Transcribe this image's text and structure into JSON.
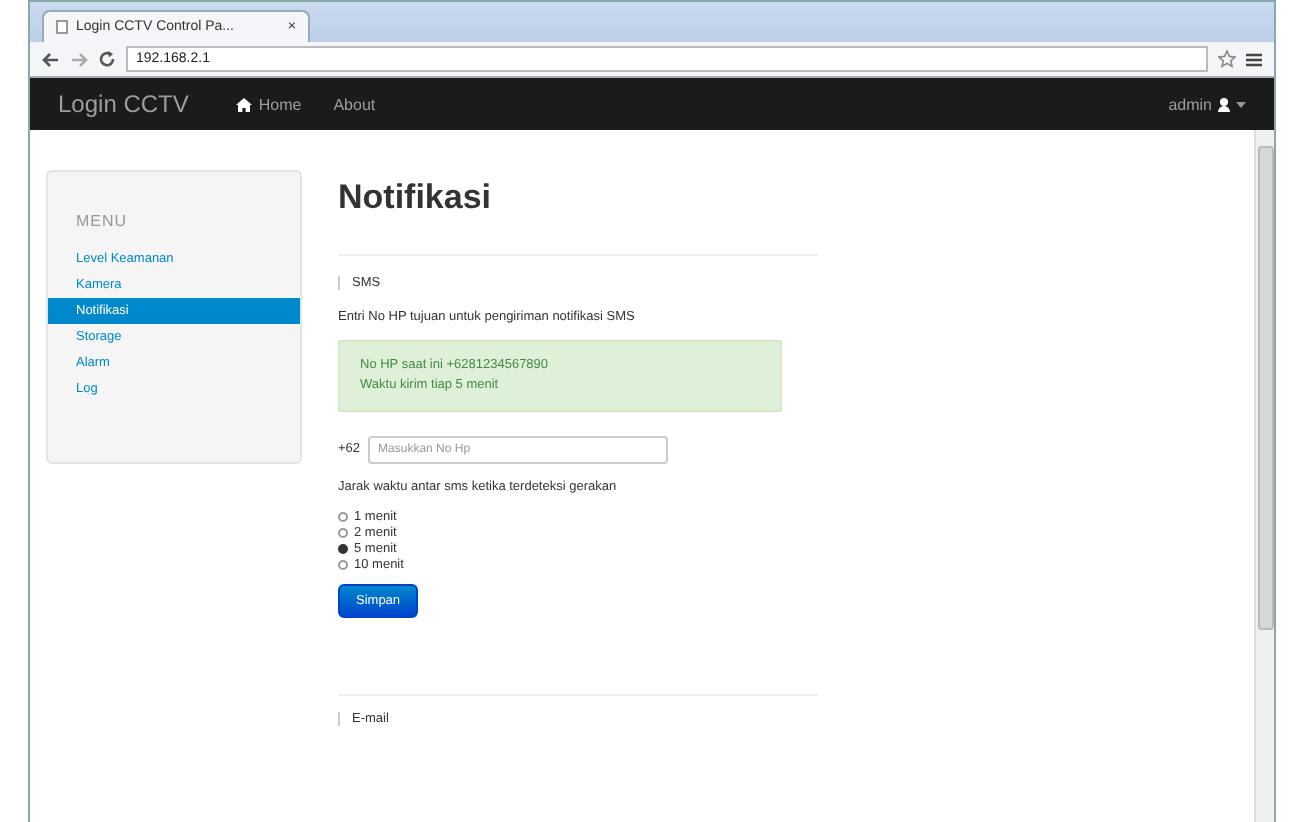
{
  "browser": {
    "tab_title": "Login CCTV Control Pa...",
    "tab_close": "×",
    "url": "192.168.2.1"
  },
  "navbar": {
    "brand": "Login CCTV",
    "links": [
      "Home",
      "About"
    ],
    "user": "admin"
  },
  "sidebar": {
    "heading": "MENU",
    "items": [
      {
        "label": "Level Keamanan",
        "selected": false
      },
      {
        "label": "Kamera",
        "selected": false
      },
      {
        "label": "Notifikasi",
        "selected": true
      },
      {
        "label": "Storage",
        "selected": false
      },
      {
        "label": "Alarm",
        "selected": false
      },
      {
        "label": "Log",
        "selected": false
      }
    ]
  },
  "main": {
    "title": "Notifikasi",
    "sms": {
      "legend": "SMS",
      "instruction": "Entri No HP tujuan untuk pengiriman notifikasi SMS",
      "alert_lines": [
        "No HP saat ini +6281234567890",
        "Waktu kirim tiap 5 menit"
      ],
      "prefix": "+62",
      "placeholder": "Masukkan No Hp",
      "interval_label": "Jarak waktu antar sms ketika terdeteksi gerakan",
      "options": [
        {
          "label": "1 menit",
          "selected": false
        },
        {
          "label": "2 menit",
          "selected": false
        },
        {
          "label": "5 menit",
          "selected": true
        },
        {
          "label": "10 menit",
          "selected": false
        }
      ],
      "button": "Simpan"
    },
    "email": {
      "legend": "E-mail"
    }
  }
}
